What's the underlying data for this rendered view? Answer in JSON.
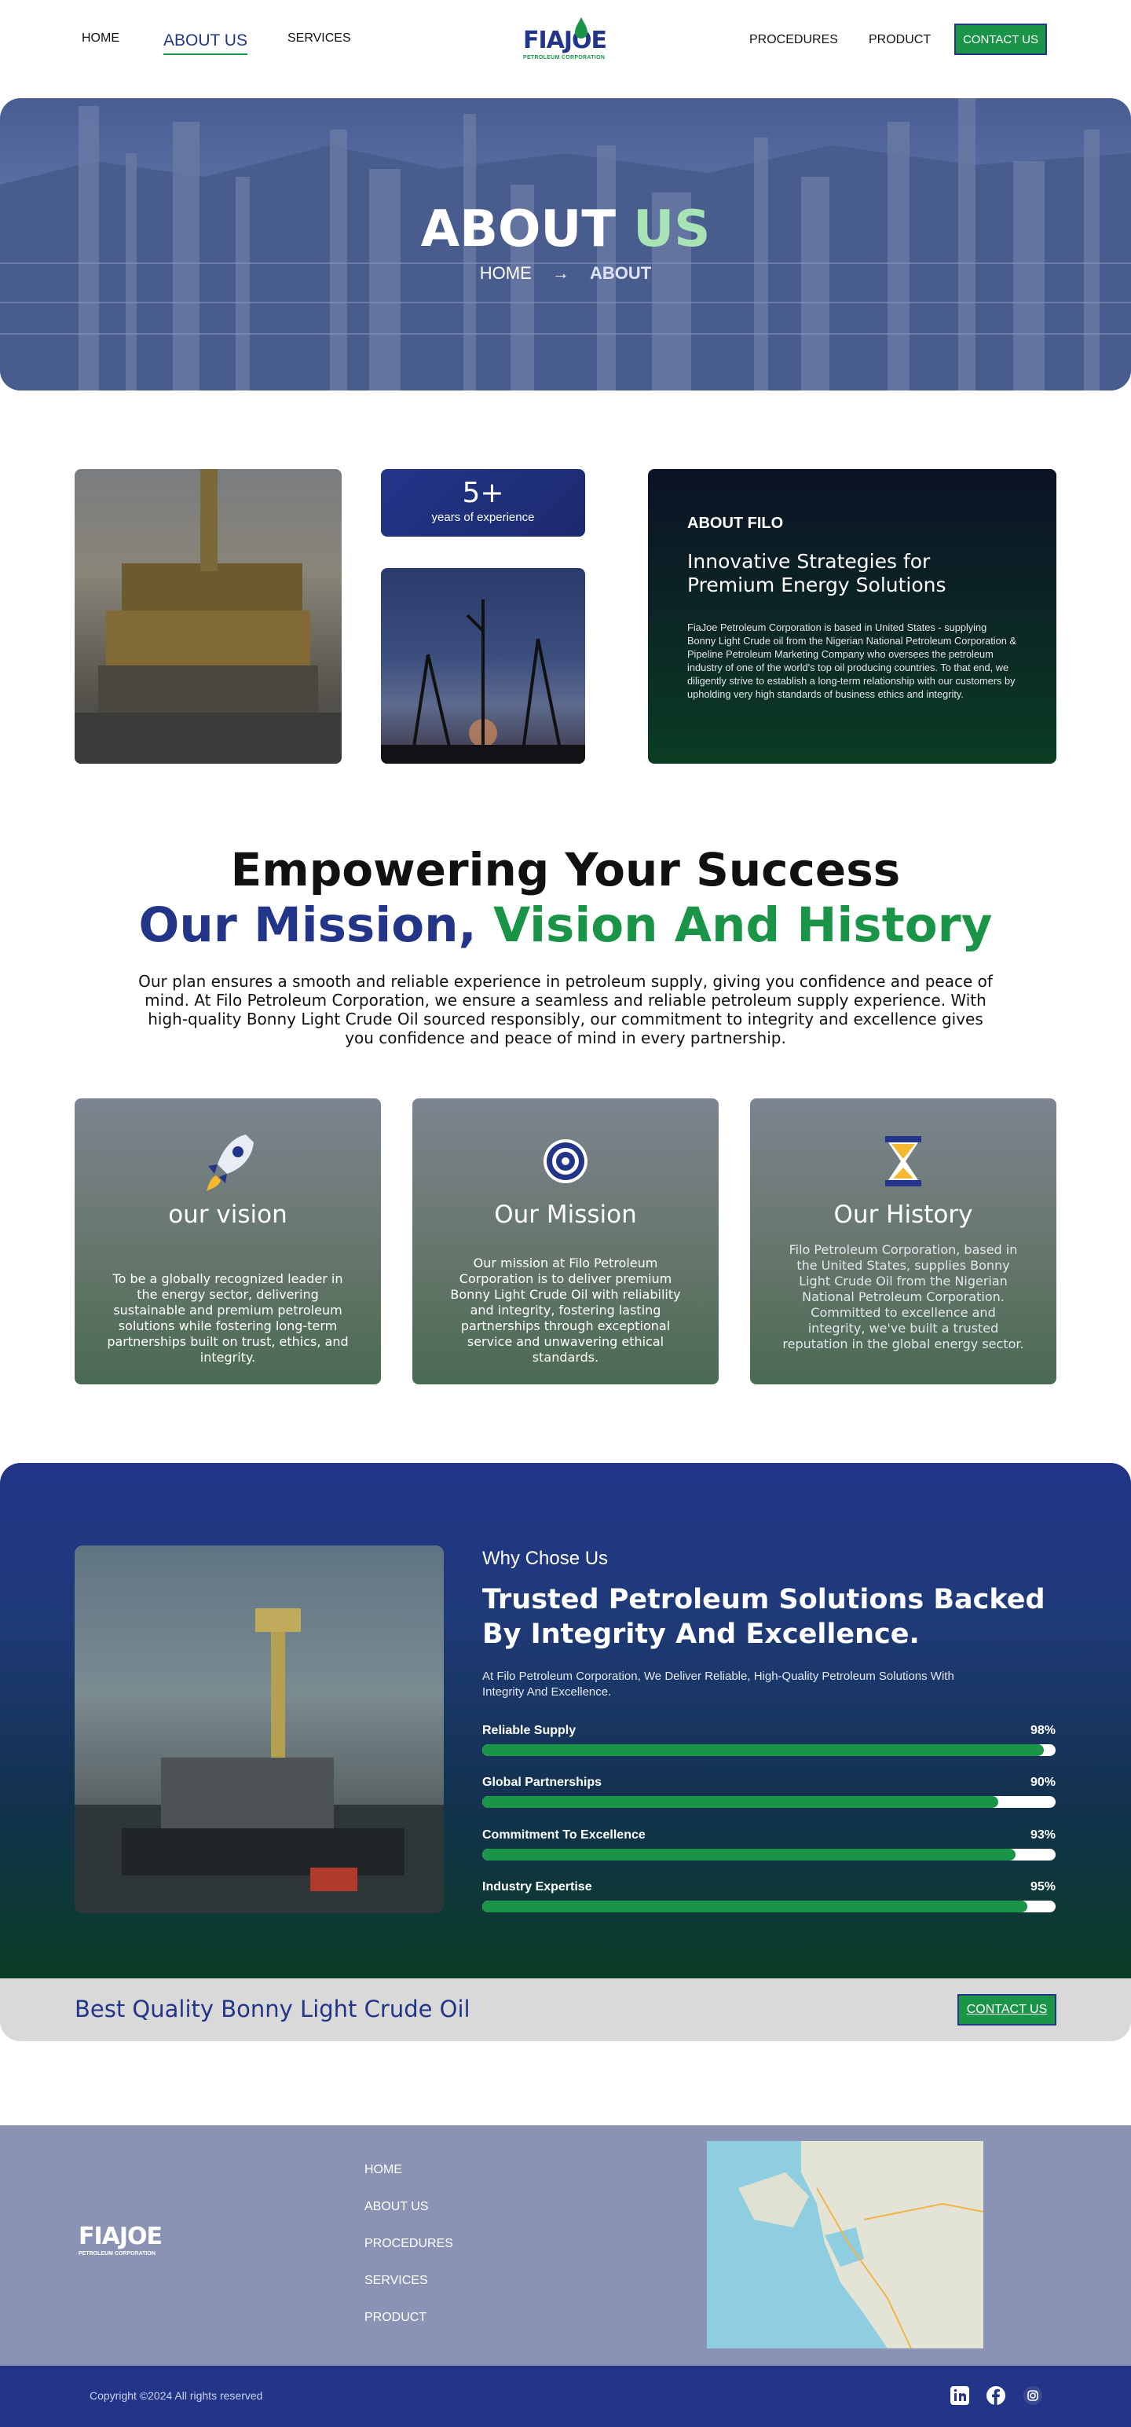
{
  "nav": {
    "home": "HOME",
    "about": "ABOUT US",
    "services": "SERVICES",
    "procedures": "PROCEDURES",
    "product": "PRODUCT",
    "contact": "CONTACT US"
  },
  "logo": {
    "word": "FIAJOE",
    "sub": "PETROLEUM CORPORATION"
  },
  "hero": {
    "title_a": "ABOUT",
    "title_b": "US",
    "crumb_home": "HOME",
    "crumb_sep": "→",
    "crumb_current": "ABOUT"
  },
  "experience": {
    "number": "5+",
    "label": "years of experience"
  },
  "about_filo": {
    "tag": "ABOUT FILO",
    "heading": "Innovative Strategies for Premium Energy Solutions",
    "text": "FiaJoe Petroleum Corporation is based in United States - supplying Bonny Light Crude oil from the Nigerian National Petroleum Corporation & Pipeline Petroleum Marketing Company who oversees the petroleum industry of one of the world's top oil producing countries. To that end, we diligently strive to establish a long-term relationship with our customers by upholding very high standards of business ethics and integrity."
  },
  "empower": {
    "line1": "Empowering Your Success",
    "line2_a": "Our Mission,",
    "line2_b": "Vision And History",
    "text": "Our plan ensures a smooth and reliable experience in petroleum supply, giving you confidence and peace of mind. At Filo Petroleum Corporation, we ensure a seamless and reliable petroleum supply experience. With high-quality Bonny Light Crude Oil sourced responsibly, our commitment to integrity and excellence gives you confidence and peace of mind in every partnership."
  },
  "cards": [
    {
      "title": "our vision",
      "icon": "rocket-icon",
      "text": "To be a globally recognized leader in the energy sector, delivering sustainable and premium petroleum solutions while fostering long-term partnerships built on trust, ethics, and integrity."
    },
    {
      "title": "Our Mission",
      "icon": "target-icon",
      "text": "Our mission at Filo Petroleum Corporation is to deliver premium Bonny Light Crude Oil with reliability and integrity, fostering lasting partnerships through exceptional service and unwavering ethical standards."
    },
    {
      "title": "Our History",
      "icon": "hourglass-icon",
      "text": "Filo Petroleum Corporation, based in the United States, supplies Bonny Light Crude Oil from the Nigerian National Petroleum Corporation. Committed to excellence and integrity, we've built a trusted reputation in the global energy sector."
    }
  ],
  "why": {
    "small": "Why Chose Us",
    "heading": "Trusted Petroleum Solutions Backed By Integrity And Excellence.",
    "sub": "At Filo Petroleum Corporation, We Deliver Reliable, High-Quality Petroleum Solutions With Integrity And Excellence.",
    "bars": [
      {
        "label": "Reliable Supply",
        "value": "98%",
        "fraction": 0.98
      },
      {
        "label": "Global Partnerships",
        "value": "90%",
        "fraction": 0.9
      },
      {
        "label": "Commitment To Excellence",
        "value": "93%",
        "fraction": 0.93
      },
      {
        "label": "Industry Expertise",
        "value": "95%",
        "fraction": 0.95
      }
    ]
  },
  "best": {
    "text": "Best Quality Bonny Light Crude Oil",
    "button": "CONTACT US"
  },
  "footer": {
    "links": [
      "HOME",
      "ABOUT US",
      "PROCEDURES",
      "SERVICES",
      "PRODUCT"
    ],
    "copyright": "Copyright ©2024 All rights reserved",
    "social": [
      "linkedin-icon",
      "facebook-icon",
      "instagram-icon"
    ]
  },
  "colors": {
    "brand_blue": "#223589",
    "brand_green": "#1a9447",
    "footer": "#8b93b4"
  }
}
